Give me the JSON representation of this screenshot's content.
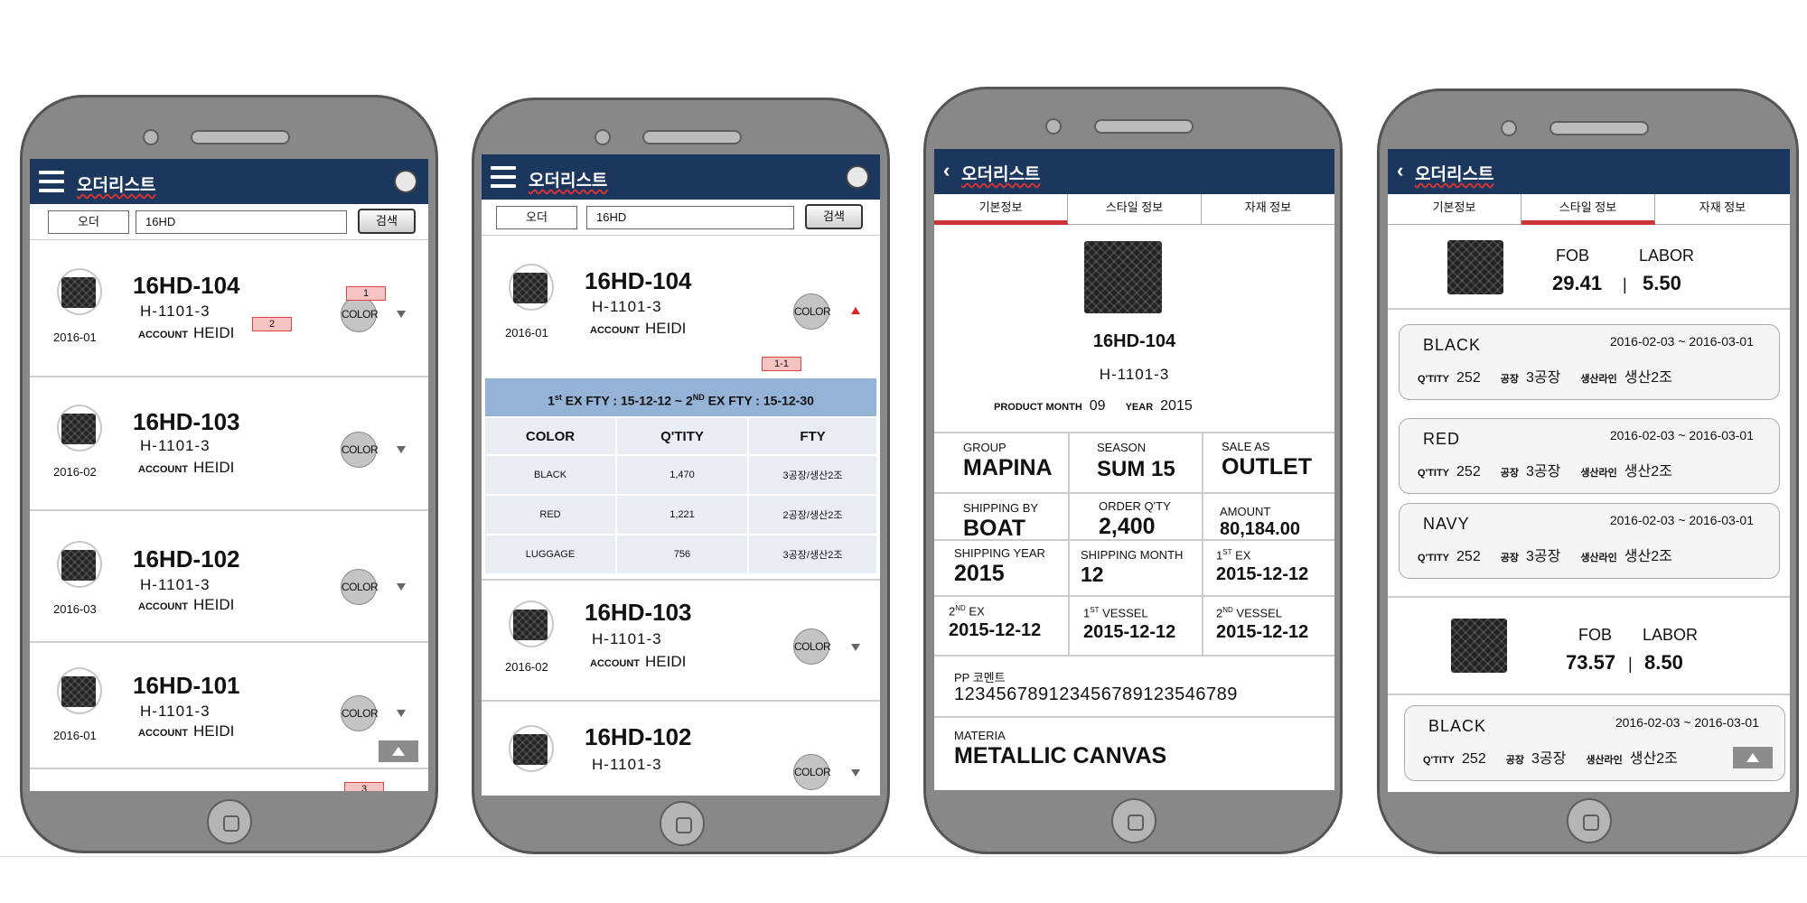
{
  "list_screen": {
    "title": "오더리스트",
    "search": {
      "select": "오더",
      "query": "16HD",
      "button": "검색"
    },
    "account_label": "ACCOUNT",
    "color_label": "COLOR",
    "orders": [
      {
        "code": "16HD-104",
        "style": "H-1101-3",
        "date": "2016-01",
        "account": "HEIDI"
      },
      {
        "code": "16HD-103",
        "style": "H-1101-3",
        "date": "2016-02",
        "account": "HEIDI"
      },
      {
        "code": "16HD-102",
        "style": "H-1101-3",
        "date": "2016-03",
        "account": "HEIDI"
      },
      {
        "code": "16HD-101",
        "style": "H-1101-3",
        "date": "2016-01",
        "account": "HEIDI"
      }
    ],
    "annotations": {
      "a1": "1",
      "a2": "2",
      "a3": "3"
    }
  },
  "expanded_screen": {
    "title": "오더리스트",
    "search": {
      "select": "오더",
      "query": "16HD",
      "button": "검색"
    },
    "account_label": "ACCOUNT",
    "color_label": "COLOR",
    "expanded_order": {
      "code": "16HD-104",
      "style": "H-1101-3",
      "date": "2016-01",
      "account": "HEIDI"
    },
    "annotation": "1-1",
    "fty_bar": {
      "first_ord": "1",
      "first_sup": "st",
      "first_text": " EX FTY : 15-12-12 ~ 2",
      "second_sup": "ND",
      "second_text": " EX FTY : 15-12-30"
    },
    "color_table": {
      "headers": [
        "COLOR",
        "Q'TITY",
        "FTY"
      ],
      "rows": [
        [
          "BLACK",
          "1,470",
          "3공장/생산2조"
        ],
        [
          "RED",
          "1,221",
          "2공장/생산2조"
        ],
        [
          "LUGGAGE",
          "756",
          "3공장/생산2조"
        ]
      ]
    },
    "orders": [
      {
        "code": "16HD-103",
        "style": "H-1101-3",
        "date": "2016-02",
        "account": "HEIDI"
      },
      {
        "code": "16HD-102",
        "style": "H-1101-3"
      }
    ]
  },
  "detail_screen": {
    "title": "오더리스트",
    "tabs": [
      "기본정보",
      "스타일 정보",
      "자재 정보"
    ],
    "active_tab": 0,
    "product": {
      "code": "16HD-104",
      "style": "H-1101-3",
      "month_label": "PRODUCT MONTH",
      "month": "09",
      "year_label": "YEAR",
      "year": "2015"
    },
    "fields": {
      "group": {
        "label": "GROUP",
        "value": "MAPINA"
      },
      "season": {
        "label": "SEASON",
        "value": "SUM 15"
      },
      "sale_as": {
        "label": "SALE AS",
        "value": "OUTLET"
      },
      "shipping_by": {
        "label": "SHIPPING BY",
        "value": "BOAT"
      },
      "order_qty": {
        "label": "ORDER Q'TY",
        "value": "2,400"
      },
      "amount": {
        "label": "AMOUNT",
        "value": "80,184.00"
      },
      "shipping_year": {
        "label": "SHIPPING YEAR",
        "value": "2015"
      },
      "shipping_month": {
        "label": "SHIPPING MONTH",
        "value": "12"
      },
      "ex1": {
        "ord": "1",
        "sup": "ST",
        "label": " EX",
        "value": "2015-12-12"
      },
      "ex2": {
        "ord": "2",
        "sup": "ND",
        "label": " EX",
        "value": "2015-12-12"
      },
      "vessel1": {
        "ord": "1",
        "sup": "ST",
        "label": " VESSEL",
        "value": "2015-12-12"
      },
      "vessel2": {
        "ord": "2",
        "sup": "ND",
        "label": " VESSEL",
        "value": "2015-12-12"
      },
      "pp_comment": {
        "label": "PP 코멘트",
        "value": "123456789123456789123546789"
      },
      "materia": {
        "label": "MATERIA",
        "value": "METALLIC CANVAS"
      }
    }
  },
  "style_screen": {
    "title": "오더리스트",
    "tabs": [
      "기본정보",
      "스타일 정보",
      "자재 정보"
    ],
    "active_tab": 1,
    "fob_label": "FOB",
    "labor_label": "LABOR",
    "qty_label": "Q'TITY",
    "factory_label": "공장",
    "line_label": "생산라인",
    "styles": [
      {
        "fob": "29.41",
        "labor": "5.50",
        "colors": [
          {
            "name": "BLACK",
            "period": "2016-02-03 ~ 2016-03-01",
            "qty": "252",
            "factory": "3공장",
            "line": "생산2조"
          },
          {
            "name": "RED",
            "period": "2016-02-03 ~ 2016-03-01",
            "qty": "252",
            "factory": "3공장",
            "line": "생산2조"
          },
          {
            "name": "NAVY",
            "period": "2016-02-03 ~ 2016-03-01",
            "qty": "252",
            "factory": "3공장",
            "line": "생산2조"
          }
        ]
      },
      {
        "fob": "73.57",
        "labor": "8.50",
        "colors": [
          {
            "name": "BLACK",
            "period": "2016-02-03 ~ 2016-03-01",
            "qty": "252",
            "factory": "3공장",
            "line": "생산2조"
          }
        ]
      }
    ]
  },
  "colors": {
    "appbar": "#1c375e",
    "active_tab": "#cc3333",
    "fty_bar": "#95b3d7",
    "annotation": "#f6c3c3"
  }
}
